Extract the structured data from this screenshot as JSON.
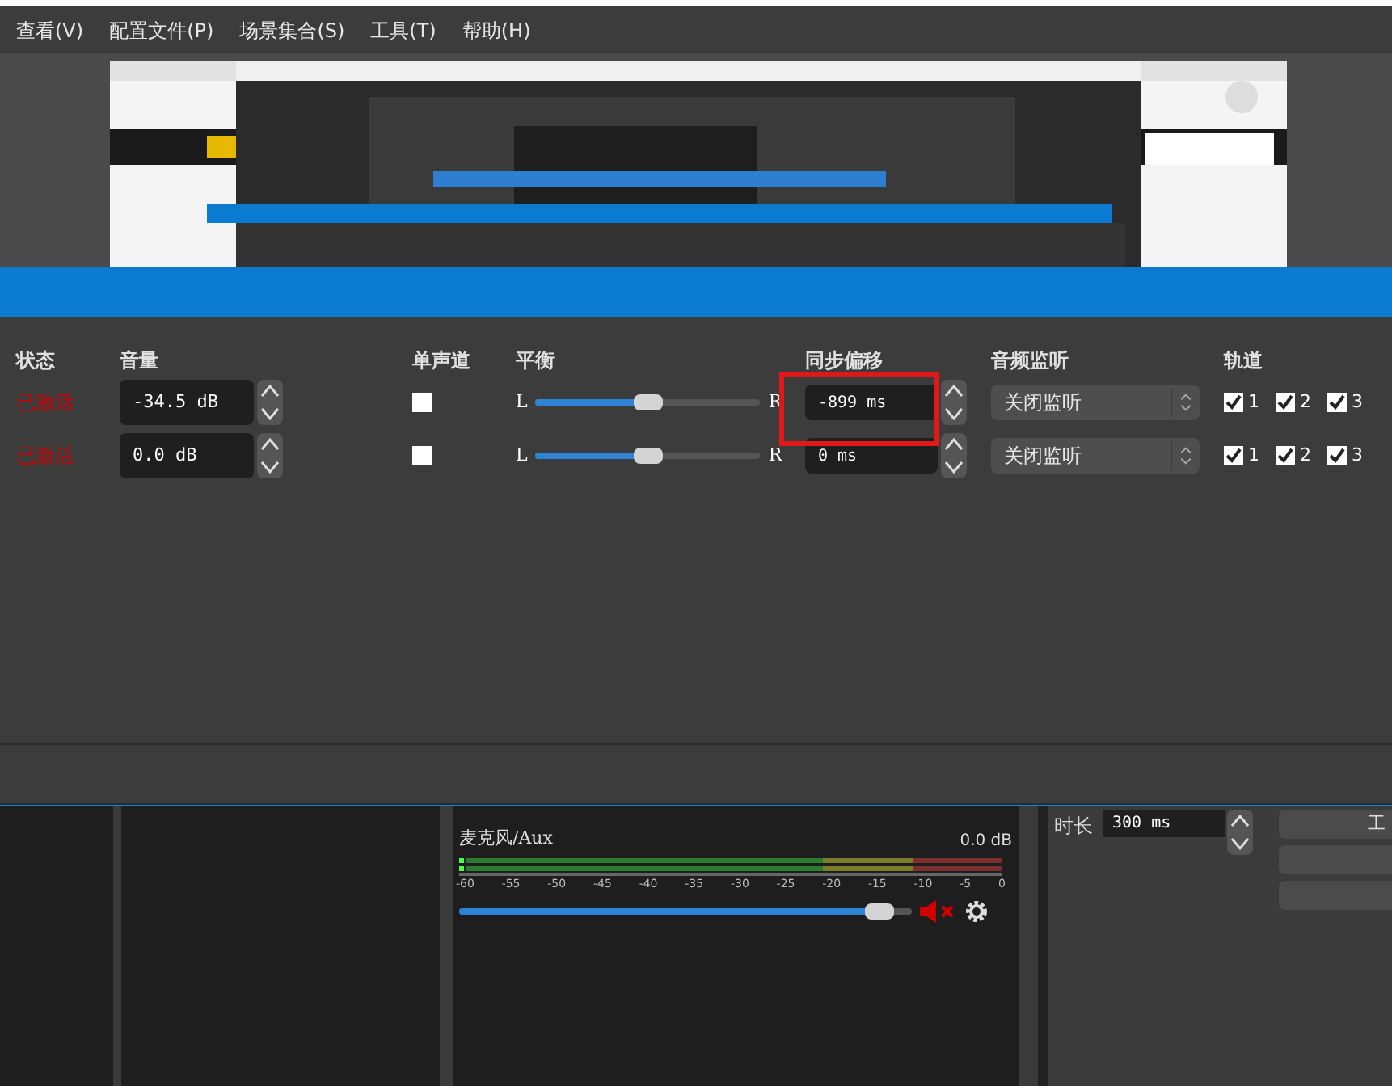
{
  "menu": [
    "查看(V)",
    "配置文件(P)",
    "场景集合(S)",
    "工具(T)",
    "帮助(H)"
  ],
  "dialog": {
    "columns": [
      "状态",
      "音量",
      "单声道",
      "平衡",
      "同步偏移",
      "音频监听",
      "轨道"
    ],
    "highlight_sync_offset": true,
    "rows": [
      {
        "status": "已激活",
        "volume": "-34.5 dB",
        "mono": false,
        "balance_left": "L",
        "balance_right": "R",
        "level": 0.5,
        "sync_offset": "-899 ms",
        "monitoring": "关闭监听",
        "tracks": [
          {
            "label": "1",
            "checked": true
          },
          {
            "label": "2",
            "checked": true
          },
          {
            "label": "3",
            "checked": true
          }
        ]
      },
      {
        "status": "已激活",
        "volume": "0.0 dB",
        "mono": false,
        "balance_left": "L",
        "balance_right": "R",
        "level": 0.5,
        "sync_offset": "0 ms",
        "monitoring": "关闭监听",
        "tracks": [
          {
            "label": "1",
            "checked": true
          },
          {
            "label": "2",
            "checked": true
          },
          {
            "label": "3",
            "checked": true
          }
        ]
      }
    ]
  },
  "mixer": {
    "name": "麦克风/Aux",
    "reading": "0.0 dB",
    "ticks": [
      "-60",
      "-55",
      "-50",
      "-45",
      "-40",
      "-35",
      "-30",
      "-25",
      "-20",
      "-15",
      "-10",
      "-5",
      "0"
    ],
    "level": 0.96,
    "muted": true
  },
  "transition": {
    "duration_label": "时长",
    "duration": "300 ms",
    "buttons": [
      {
        "kind": "labeled",
        "label": "工"
      },
      {
        "kind": "blank"
      },
      {
        "kind": "blank"
      }
    ]
  }
}
